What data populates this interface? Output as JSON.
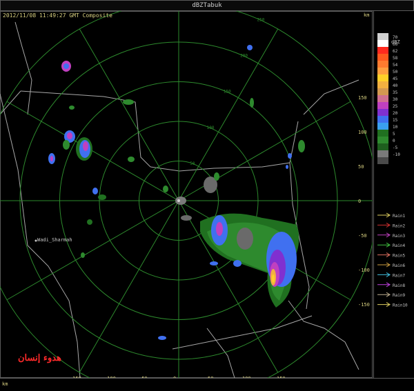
{
  "window": {
    "title": "dBZTabuk"
  },
  "status": {
    "timestamp_line": "2012/11/08 11:49:27 GMT Composite"
  },
  "units": {
    "corner_top": "km",
    "corner_bottom": "km"
  },
  "axes": {
    "x_ticks": [
      "-150",
      "-100",
      "-50",
      "0",
      "50",
      "100",
      "150"
    ],
    "y_ticks": [
      "150",
      "100",
      "50",
      "0",
      "-50",
      "-100",
      "-150"
    ],
    "ring_labels": [
      "50",
      "100",
      "150",
      "200",
      "250"
    ]
  },
  "places": {
    "town_label": "Wadi_Sharmah"
  },
  "legend": {
    "unit": "dBZ",
    "bins": [
      {
        "label": "70",
        "color": "#d0d0d0"
      },
      {
        "label": "66",
        "color": "#ffffff"
      },
      {
        "label": "62",
        "color": "#ff2a1f"
      },
      {
        "label": "58",
        "color": "#ff5a1f"
      },
      {
        "label": "54",
        "color": "#ff7b2f"
      },
      {
        "label": "50",
        "color": "#ff9f3f"
      },
      {
        "label": "45",
        "color": "#ffd028"
      },
      {
        "label": "40",
        "color": "#f2b040"
      },
      {
        "label": "35",
        "color": "#d39850"
      },
      {
        "label": "30",
        "color": "#d07090"
      },
      {
        "label": "25",
        "color": "#c040c0"
      },
      {
        "label": "20",
        "color": "#8030d0"
      },
      {
        "label": "15",
        "color": "#4070f0"
      },
      {
        "label": "10",
        "color": "#3aa0f0"
      },
      {
        "label": "5",
        "color": "#207020"
      },
      {
        "label": "0",
        "color": "#2e8a2e"
      },
      {
        "label": "-5",
        "color": "#1e5e1e"
      },
      {
        "label": "-10",
        "color": "#7a7a7a"
      },
      {
        "label": "",
        "color": "#4a4a4a"
      }
    ],
    "rain_lines": [
      {
        "label": "Rain1",
        "color": "#e0d060"
      },
      {
        "label": "Rain2",
        "color": "#d03030"
      },
      {
        "label": "Rain3",
        "color": "#c040c0"
      },
      {
        "label": "Rain4",
        "color": "#40c040"
      },
      {
        "label": "Rain5",
        "color": "#e07060"
      },
      {
        "label": "Rain6",
        "color": "#d0a040"
      },
      {
        "label": "Rain7",
        "color": "#40c0e0"
      },
      {
        "label": "Rain8",
        "color": "#c040e0"
      },
      {
        "label": "Rain9",
        "color": "#c0b090"
      },
      {
        "label": "Rain10",
        "color": "#e0d060"
      }
    ]
  },
  "watermark": {
    "text": "هدوء إنسان"
  },
  "colors": {
    "grid": "#2d8a2d",
    "boundary": "#a8a8a8",
    "axis_text": "#d8d080"
  }
}
